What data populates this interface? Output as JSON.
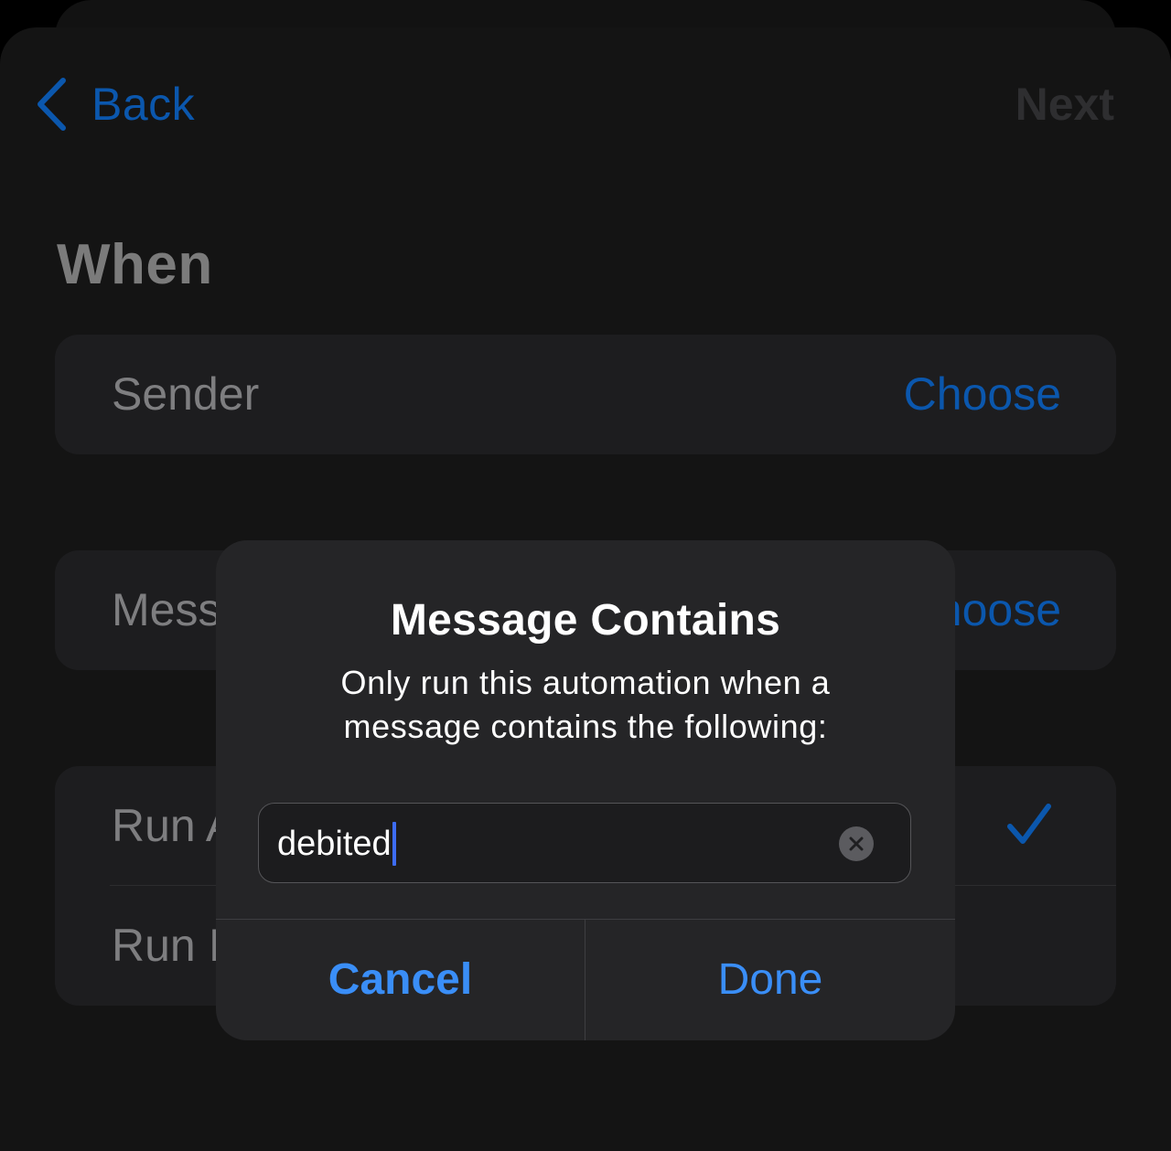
{
  "nav": {
    "back_label": "Back",
    "next_label": "Next"
  },
  "section": {
    "title": "When"
  },
  "rows": {
    "sender": {
      "label": "Sender",
      "value": "Choose"
    },
    "message": {
      "label": "Mess",
      "value": "noose"
    },
    "run_after": {
      "label": "Run A"
    },
    "run_immediately": {
      "label": "Run I"
    }
  },
  "dialog": {
    "title": "Message Contains",
    "message": "Only run this automation when a message contains the following:",
    "input_value": "debited",
    "cancel_label": "Cancel",
    "done_label": "Done"
  },
  "colors": {
    "accent": "#3a8ef7",
    "accent_dimmed": "#0b57ad",
    "background": "#000000",
    "card": "#1d1d1f",
    "dialog": "#252527"
  },
  "icons": {
    "back": "chevron-left-icon",
    "check": "checkmark-icon",
    "clear": "clear-x-icon"
  }
}
